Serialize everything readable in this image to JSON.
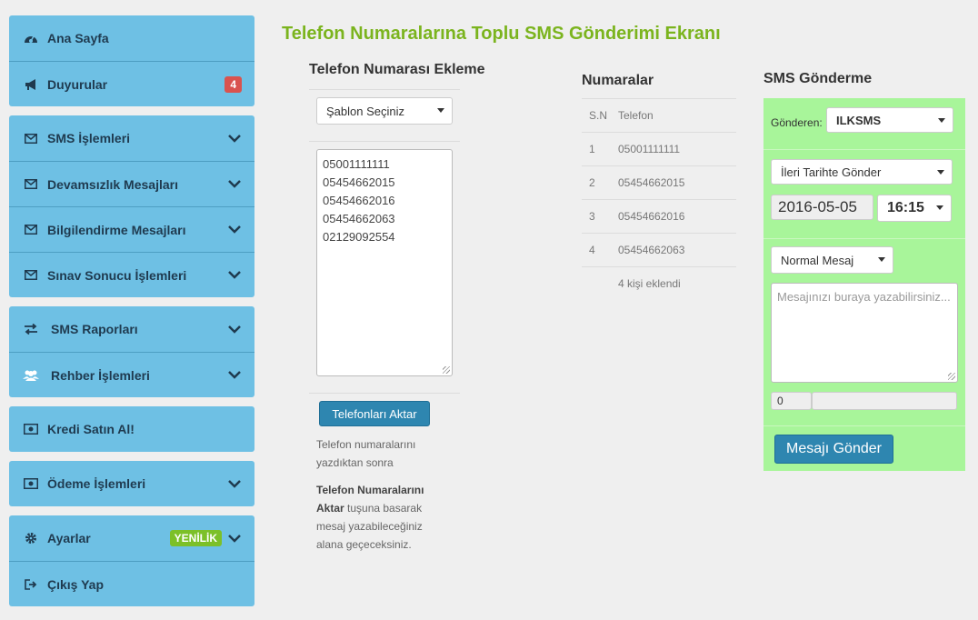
{
  "sidebar": {
    "home": "Ana Sayfa",
    "announcements": "Duyurular",
    "announcements_count": "4",
    "sms_ops": "SMS İşlemleri",
    "absence_msgs": "Devamsızlık Mesajları",
    "info_msgs": "Bilgilendirme Mesajları",
    "exam_results": "Sınav Sonucu İşlemleri",
    "sms_reports": "SMS Raporları",
    "contacts": "Rehber İşlemleri",
    "buy_credit": "Kredi Satın Al!",
    "payments": "Ödeme İşlemleri",
    "settings": "Ayarlar",
    "settings_badge": "YENİLİK",
    "logout": "Çıkış Yap"
  },
  "page_title": "Telefon Numaralarına Toplu SMS Gönderimi Ekranı",
  "add_numbers": {
    "heading": "Telefon Numarası Ekleme",
    "template_select": "Şablon Seçiniz",
    "numbers": [
      "05001111111",
      "05454662015",
      "05454662016",
      "05454662063",
      "02129092554"
    ],
    "transfer_button": "Telefonları Aktar",
    "help_1": "Telefon numaralarını yazdıktan sonra",
    "help_2_bold": "Telefon Numaralarını Aktar",
    "help_2_rest": " tuşuna basarak mesaj yazabileceğiniz alana geçeceksiniz."
  },
  "numbers_table": {
    "heading": "Numaralar",
    "columns": [
      "S.N",
      "Telefon"
    ],
    "rows": [
      {
        "sn": "1",
        "phone": "05001111111"
      },
      {
        "sn": "2",
        "phone": "05454662015"
      },
      {
        "sn": "3",
        "phone": "05454662016"
      },
      {
        "sn": "4",
        "phone": "05454662063"
      }
    ],
    "footer": "4 kişi eklendi"
  },
  "sms_send": {
    "heading": "SMS Gönderme",
    "sender_label": "Gönderen:",
    "sender_value": "ILKSMS",
    "schedule_select": "İleri Tarihte Gönder",
    "date_value": "2016-05-05",
    "time_value": "16:15",
    "message_type": "Normal Mesaj",
    "message_placeholder": "Mesajınızı buraya yazabilirsiniz...",
    "char_count": "0",
    "send_button": "Mesajı Gönder"
  },
  "colors": {
    "sidebar_bg": "#6ec0e4",
    "title_green": "#7bb41e",
    "panel_green": "#a8f59a",
    "button_blue": "#2e86b0"
  }
}
